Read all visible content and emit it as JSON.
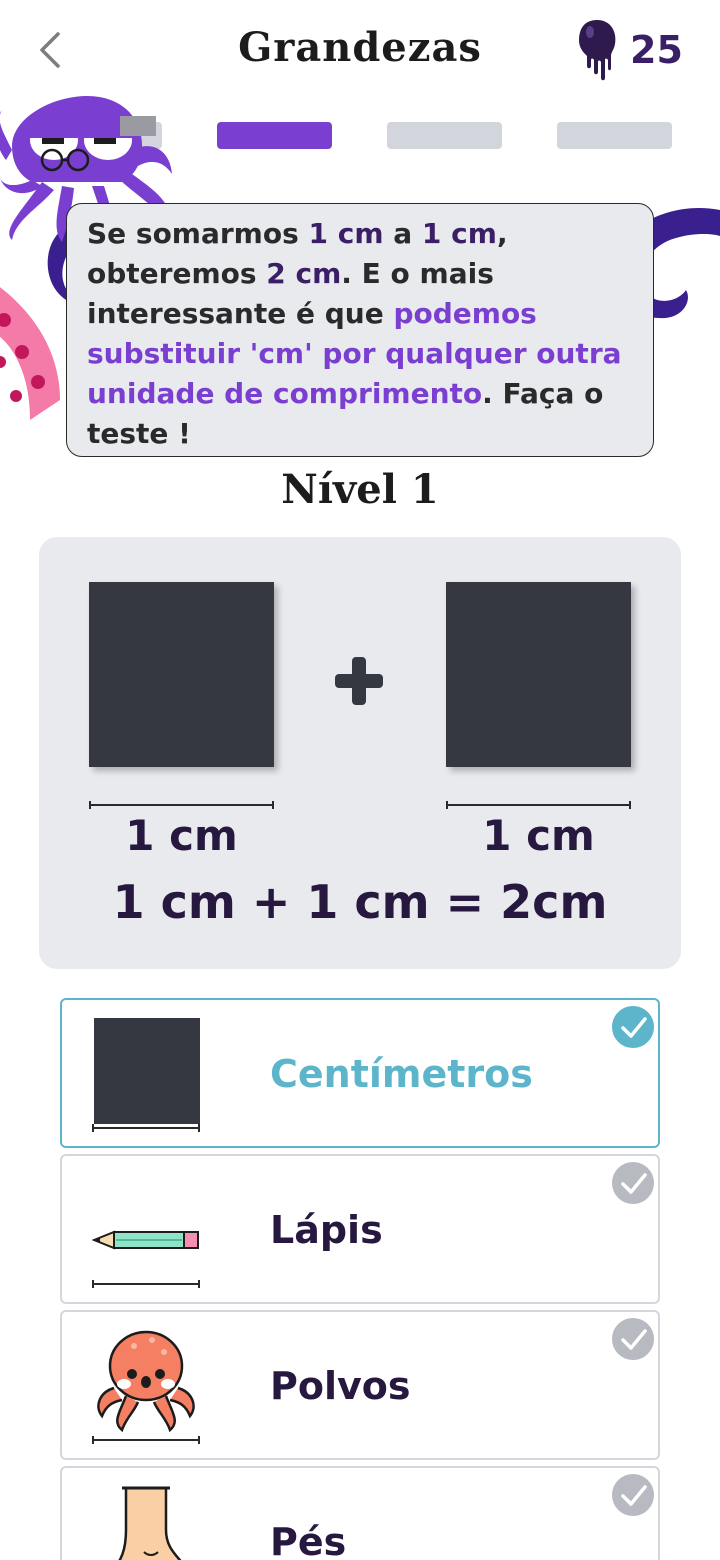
{
  "header": {
    "title": "Grandezas",
    "ink_count": "25",
    "back_icon": "chevron-left-icon",
    "ink_icon": "ink-drop-icon"
  },
  "progress": {
    "total_steps": 4,
    "current_step": 2
  },
  "speech": {
    "part1": "Se somarmos ",
    "hl1": "1 cm",
    "part2": " a ",
    "hl2": "1 cm",
    "part3": ", obteremos ",
    "hl3": "2 cm",
    "part4": ". E o mais interessante é que ",
    "hl4": "podemos substituir 'cm' por qualquer outra unidade de comprimento",
    "part5": ". Faça o teste !"
  },
  "level": "Nível 1",
  "demo": {
    "left_label": "1 cm",
    "right_label": "1 cm",
    "equation": "1 cm + 1 cm = 2cm"
  },
  "options": [
    {
      "label": "Centímetros",
      "icon": "square-icon",
      "selected": true
    },
    {
      "label": "Lápis",
      "icon": "pencil-icon",
      "selected": false
    },
    {
      "label": "Polvos",
      "icon": "octopus-icon",
      "selected": false
    },
    {
      "label": "Pés",
      "icon": "foot-icon",
      "selected": false
    }
  ],
  "colors": {
    "accent_purple": "#7a3fd0",
    "dark_purple": "#3b1f66",
    "selected_teal": "#5db5cb",
    "panel_gray": "#e8eaee"
  }
}
